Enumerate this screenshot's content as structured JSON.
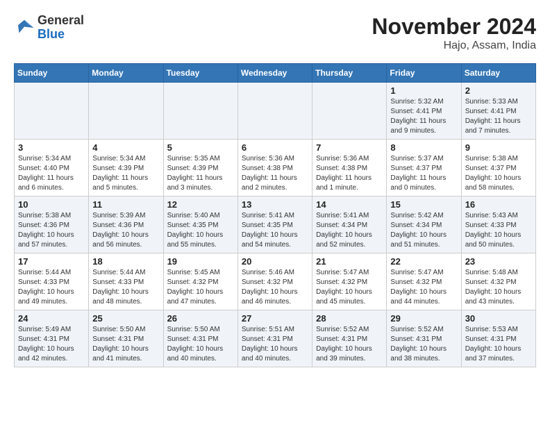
{
  "logo": {
    "general": "General",
    "blue": "Blue"
  },
  "title": "November 2024",
  "subtitle": "Hajo, Assam, India",
  "days_of_week": [
    "Sunday",
    "Monday",
    "Tuesday",
    "Wednesday",
    "Thursday",
    "Friday",
    "Saturday"
  ],
  "weeks": [
    [
      {
        "day": "",
        "info": ""
      },
      {
        "day": "",
        "info": ""
      },
      {
        "day": "",
        "info": ""
      },
      {
        "day": "",
        "info": ""
      },
      {
        "day": "",
        "info": ""
      },
      {
        "day": "1",
        "info": "Sunrise: 5:32 AM\nSunset: 4:41 PM\nDaylight: 11 hours\nand 9 minutes."
      },
      {
        "day": "2",
        "info": "Sunrise: 5:33 AM\nSunset: 4:41 PM\nDaylight: 11 hours\nand 7 minutes."
      }
    ],
    [
      {
        "day": "3",
        "info": "Sunrise: 5:34 AM\nSunset: 4:40 PM\nDaylight: 11 hours\nand 6 minutes."
      },
      {
        "day": "4",
        "info": "Sunrise: 5:34 AM\nSunset: 4:39 PM\nDaylight: 11 hours\nand 5 minutes."
      },
      {
        "day": "5",
        "info": "Sunrise: 5:35 AM\nSunset: 4:39 PM\nDaylight: 11 hours\nand 3 minutes."
      },
      {
        "day": "6",
        "info": "Sunrise: 5:36 AM\nSunset: 4:38 PM\nDaylight: 11 hours\nand 2 minutes."
      },
      {
        "day": "7",
        "info": "Sunrise: 5:36 AM\nSunset: 4:38 PM\nDaylight: 11 hours\nand 1 minute."
      },
      {
        "day": "8",
        "info": "Sunrise: 5:37 AM\nSunset: 4:37 PM\nDaylight: 11 hours\nand 0 minutes."
      },
      {
        "day": "9",
        "info": "Sunrise: 5:38 AM\nSunset: 4:37 PM\nDaylight: 10 hours\nand 58 minutes."
      }
    ],
    [
      {
        "day": "10",
        "info": "Sunrise: 5:38 AM\nSunset: 4:36 PM\nDaylight: 10 hours\nand 57 minutes."
      },
      {
        "day": "11",
        "info": "Sunrise: 5:39 AM\nSunset: 4:36 PM\nDaylight: 10 hours\nand 56 minutes."
      },
      {
        "day": "12",
        "info": "Sunrise: 5:40 AM\nSunset: 4:35 PM\nDaylight: 10 hours\nand 55 minutes."
      },
      {
        "day": "13",
        "info": "Sunrise: 5:41 AM\nSunset: 4:35 PM\nDaylight: 10 hours\nand 54 minutes."
      },
      {
        "day": "14",
        "info": "Sunrise: 5:41 AM\nSunset: 4:34 PM\nDaylight: 10 hours\nand 52 minutes."
      },
      {
        "day": "15",
        "info": "Sunrise: 5:42 AM\nSunset: 4:34 PM\nDaylight: 10 hours\nand 51 minutes."
      },
      {
        "day": "16",
        "info": "Sunrise: 5:43 AM\nSunset: 4:33 PM\nDaylight: 10 hours\nand 50 minutes."
      }
    ],
    [
      {
        "day": "17",
        "info": "Sunrise: 5:44 AM\nSunset: 4:33 PM\nDaylight: 10 hours\nand 49 minutes."
      },
      {
        "day": "18",
        "info": "Sunrise: 5:44 AM\nSunset: 4:33 PM\nDaylight: 10 hours\nand 48 minutes."
      },
      {
        "day": "19",
        "info": "Sunrise: 5:45 AM\nSunset: 4:32 PM\nDaylight: 10 hours\nand 47 minutes."
      },
      {
        "day": "20",
        "info": "Sunrise: 5:46 AM\nSunset: 4:32 PM\nDaylight: 10 hours\nand 46 minutes."
      },
      {
        "day": "21",
        "info": "Sunrise: 5:47 AM\nSunset: 4:32 PM\nDaylight: 10 hours\nand 45 minutes."
      },
      {
        "day": "22",
        "info": "Sunrise: 5:47 AM\nSunset: 4:32 PM\nDaylight: 10 hours\nand 44 minutes."
      },
      {
        "day": "23",
        "info": "Sunrise: 5:48 AM\nSunset: 4:32 PM\nDaylight: 10 hours\nand 43 minutes."
      }
    ],
    [
      {
        "day": "24",
        "info": "Sunrise: 5:49 AM\nSunset: 4:31 PM\nDaylight: 10 hours\nand 42 minutes."
      },
      {
        "day": "25",
        "info": "Sunrise: 5:50 AM\nSunset: 4:31 PM\nDaylight: 10 hours\nand 41 minutes."
      },
      {
        "day": "26",
        "info": "Sunrise: 5:50 AM\nSunset: 4:31 PM\nDaylight: 10 hours\nand 40 minutes."
      },
      {
        "day": "27",
        "info": "Sunrise: 5:51 AM\nSunset: 4:31 PM\nDaylight: 10 hours\nand 40 minutes."
      },
      {
        "day": "28",
        "info": "Sunrise: 5:52 AM\nSunset: 4:31 PM\nDaylight: 10 hours\nand 39 minutes."
      },
      {
        "day": "29",
        "info": "Sunrise: 5:52 AM\nSunset: 4:31 PM\nDaylight: 10 hours\nand 38 minutes."
      },
      {
        "day": "30",
        "info": "Sunrise: 5:53 AM\nSunset: 4:31 PM\nDaylight: 10 hours\nand 37 minutes."
      }
    ]
  ]
}
